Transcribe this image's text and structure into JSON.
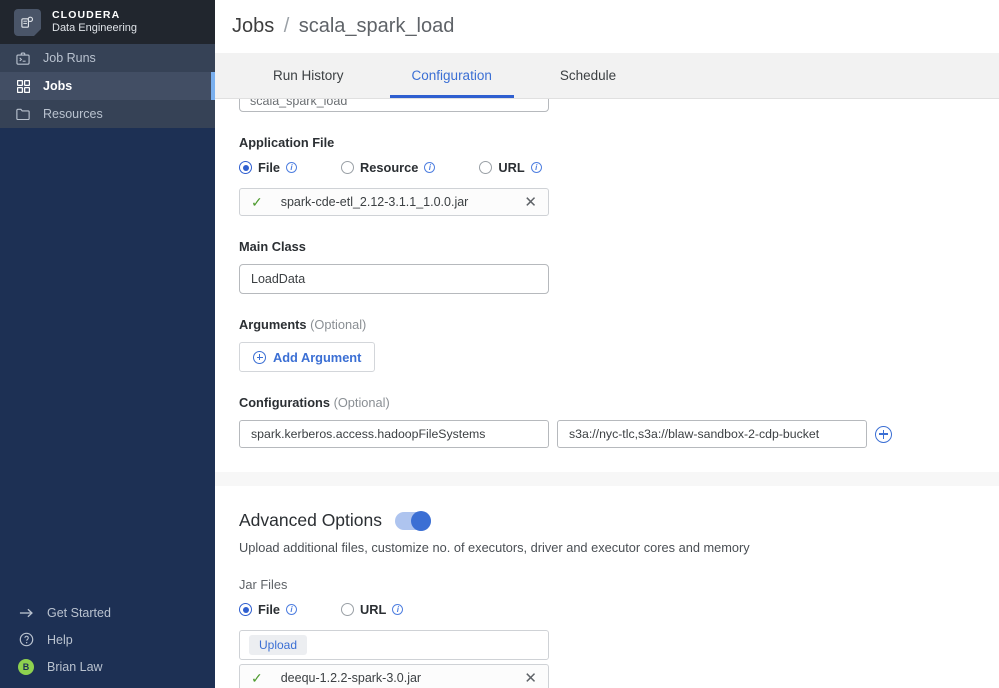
{
  "sidebar": {
    "brand": {
      "name": "CLOUDERA",
      "subtitle": "Data Engineering",
      "logo_icon": "cloudera-logo-icon"
    },
    "items": [
      {
        "label": "Job Runs",
        "icon": "terminal-briefcase-icon",
        "active": false
      },
      {
        "label": "Jobs",
        "icon": "grid-squares-icon",
        "active": true
      },
      {
        "label": "Resources",
        "icon": "folder-icon",
        "active": false
      }
    ],
    "footer": [
      {
        "label": "Get Started",
        "icon": "arrow-right-icon"
      },
      {
        "label": "Help",
        "icon": "question-circle-icon"
      },
      {
        "label": "Brian Law",
        "icon": "avatar",
        "initial": "B"
      }
    ],
    "colors": {
      "header_bg": "#21262e",
      "nav_bg": "#364256",
      "body_bg": "#1d3054",
      "active_bar": "#7ab0ef",
      "avatar_bg": "#8ed14f"
    }
  },
  "header": {
    "breadcrumb_root": "Jobs",
    "breadcrumb_separator": "/",
    "breadcrumb_current": "scala_spark_load"
  },
  "tabs": [
    {
      "label": "Run History",
      "active": false
    },
    {
      "label": "Configuration",
      "active": true
    },
    {
      "label": "Schedule",
      "active": false
    }
  ],
  "form": {
    "clipped_name_value": "scala_spark_load",
    "application_file": {
      "label": "Application File",
      "options": [
        {
          "label": "File",
          "selected": true
        },
        {
          "label": "Resource",
          "selected": false
        },
        {
          "label": "URL",
          "selected": false
        }
      ],
      "file_name": "spark-cde-etl_2.12-3.1.1_1.0.0.jar",
      "check_glyph": "✓",
      "remove_glyph": "✕"
    },
    "main_class": {
      "label": "Main Class",
      "value": "LoadData"
    },
    "arguments": {
      "label": "Arguments",
      "optional": "(Optional)",
      "add_button": "Add Argument"
    },
    "configurations": {
      "label": "Configurations",
      "optional": "(Optional)",
      "rows": [
        {
          "key": "spark.kerberos.access.hadoopFileSystems",
          "value": "s3a://nyc-tlc,s3a://blaw-sandbox-2-cdp-bucket"
        }
      ],
      "add_icon": "plus-circle-icon"
    }
  },
  "advanced": {
    "title": "Advanced Options",
    "toggle_on": true,
    "description": "Upload additional files, customize no. of executors, driver and executor cores and memory",
    "jar_files": {
      "label": "Jar Files",
      "options": [
        {
          "label": "File",
          "selected": true
        },
        {
          "label": "URL",
          "selected": false
        }
      ],
      "upload_label": "Upload",
      "file_name": "deequ-1.2.2-spark-3.0.jar",
      "check_glyph": "✓",
      "remove_glyph": "✕"
    }
  },
  "theme": {
    "accent_blue": "#3b6fd4",
    "tab_active": "#2f5fd0",
    "success_green": "#4d9b2e"
  }
}
